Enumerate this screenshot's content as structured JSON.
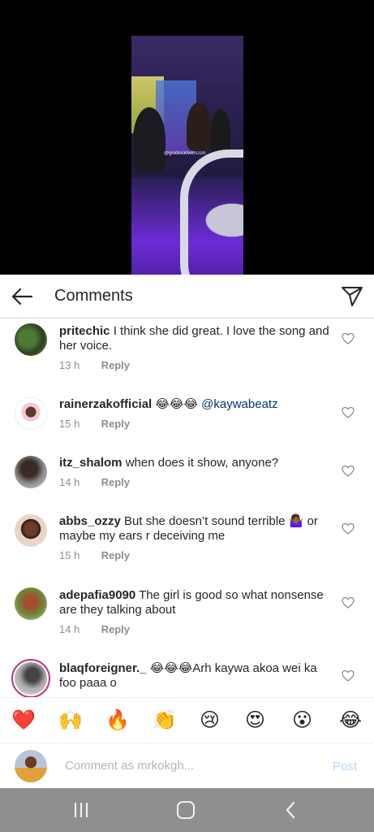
{
  "header": {
    "title": "Comments"
  },
  "video": {
    "watermark": "@goldkicktwin.com"
  },
  "comments": [
    {
      "username": "pritechic",
      "text": "I think she did great. I love the song and her voice.",
      "time": "13 h",
      "reply": "Reply"
    },
    {
      "username": "rainerzakofficial",
      "text": "😂😂😂",
      "mention": "@kaywabeatz",
      "time": "15 h",
      "reply": "Reply"
    },
    {
      "username": "itz_shalom",
      "text": "when does it show, anyone?",
      "time": "14 h",
      "reply": "Reply"
    },
    {
      "username": "abbs_ozzy",
      "text": "But she doesn’t sound terrible 🤷🏾‍♀️ or maybe my ears r deceiving me",
      "time": "15 h",
      "reply": "Reply"
    },
    {
      "username": "adepafia9090",
      "text": "The girl is good so what nonsense are they talking about",
      "time": "14 h",
      "reply": "Reply"
    },
    {
      "username": "blaqforeigner._",
      "text": "😂😂😂Arh kaywa akoa wei ka foo paaa o"
    }
  ],
  "emoji_bar": [
    "❤️",
    "🙌",
    "🔥",
    "👏",
    "😢",
    "😍",
    "😮",
    "😂"
  ],
  "compose": {
    "placeholder": "Comment as mrkokgh...",
    "post_label": "Post"
  },
  "colors": {
    "mention": "#00376b",
    "post_disabled": "#b3dbff",
    "meta": "#8e8e8e",
    "nav_bar": "#8f8f8f"
  },
  "icons": {
    "back": "arrow-left-icon",
    "send": "paper-plane-icon",
    "like": "heart-outline-icon",
    "nav_recent": "recent-apps-icon",
    "nav_home": "home-icon",
    "nav_back": "chevron-left-icon"
  }
}
